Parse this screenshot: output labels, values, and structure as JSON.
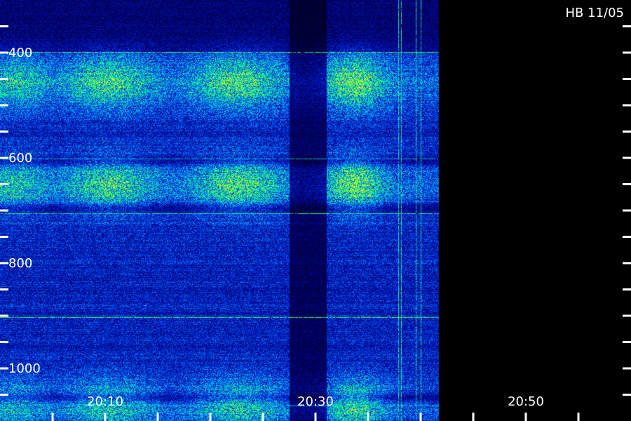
{
  "chart_data": {
    "type": "heatmap",
    "title": "",
    "corner_label": "HB 11/05",
    "xlabel": "",
    "ylabel": "",
    "x_unit": "time",
    "y_unit": "",
    "x_tick_labels": [
      "20:10",
      "20:30",
      "20:50"
    ],
    "y_tick_labels": [
      "1000",
      "800",
      "600",
      "400"
    ],
    "x_time_ticks_minutes": [
      5,
      10,
      15,
      20,
      25,
      30,
      35,
      40,
      45,
      50,
      55
    ],
    "x_time_labeled": [
      10,
      30,
      50
    ],
    "x_range_minutes": [
      0,
      60
    ],
    "y_range": [
      300,
      1100
    ],
    "y_ticks": [
      350,
      400,
      450,
      500,
      550,
      600,
      650,
      700,
      750,
      800,
      850,
      900,
      950,
      1000,
      1050
    ],
    "y_labeled": [
      400,
      600,
      800,
      1000
    ],
    "data_end_minutes": 41.67,
    "bright_columns_minutes": [
      37.9,
      38.1,
      39.5,
      40.0
    ],
    "dark_gap_minutes": [
      27.5,
      31.0
    ],
    "line_features": [
      {
        "y": 1001,
        "intensity": 0.9
      },
      {
        "y": 498,
        "intensity": 1.0
      },
      {
        "y": 798,
        "intensity": 0.2
      },
      {
        "y": 695,
        "intensity": 0.7
      },
      {
        "y": 330,
        "intensity": 0.25
      }
    ],
    "bright_bands": [
      {
        "y": 945,
        "intensity": 0.85
      },
      {
        "y": 750,
        "intensity": 0.85
      },
      {
        "y": 330,
        "intensity": 0.7
      }
    ],
    "colormap": [
      "#000000",
      "#000070",
      "#0020d0",
      "#0080ff",
      "#00e0d0",
      "#20ff60",
      "#e0ff00"
    ],
    "grid": false,
    "legend": "none"
  }
}
